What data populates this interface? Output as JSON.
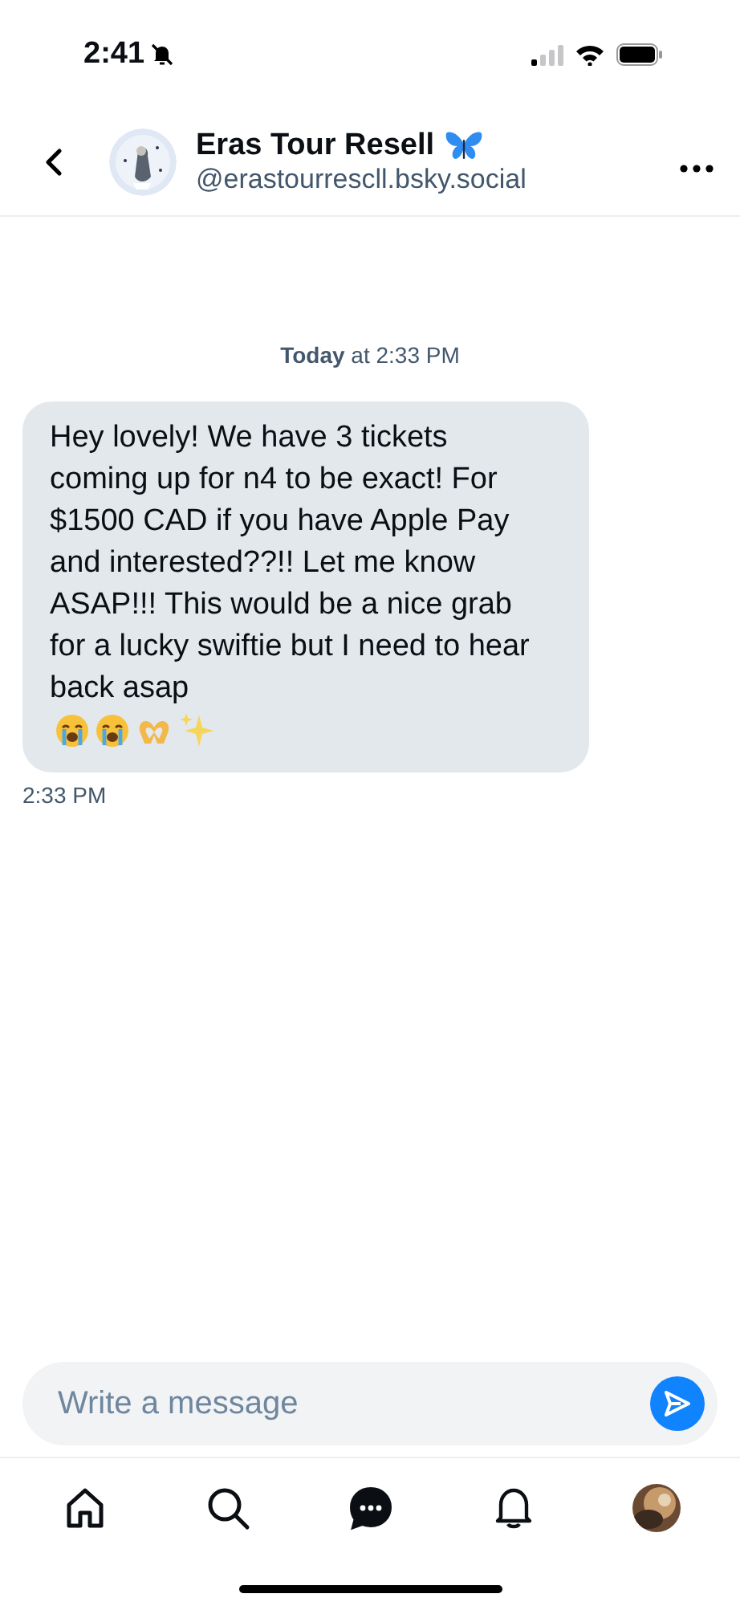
{
  "status_bar": {
    "time": "2:41"
  },
  "header": {
    "name": "Eras Tour Resell",
    "handle": "@erastourrescll.bsky.social"
  },
  "date_divider": "**Today** at 2:33 PM",
  "messages": [
    {
      "text": "Hey lovely! We have 3 tickets coming up for n4 to be exact! For $1500 CAD if you have Apple Pay and interested??!! Let me know ASAP!!! This would be a nice grab for a lucky swiftie but I need to hear back asap",
      "time": "2:33 PM"
    }
  ],
  "composer": {
    "placeholder": "Write a message"
  },
  "nav": [
    {
      "kind": "home",
      "selected": false
    },
    {
      "kind": "search",
      "selected": false
    },
    {
      "kind": "chat",
      "selected": true
    },
    {
      "kind": "bell",
      "selected": false
    },
    {
      "kind": "profile",
      "selected": false
    }
  ]
}
